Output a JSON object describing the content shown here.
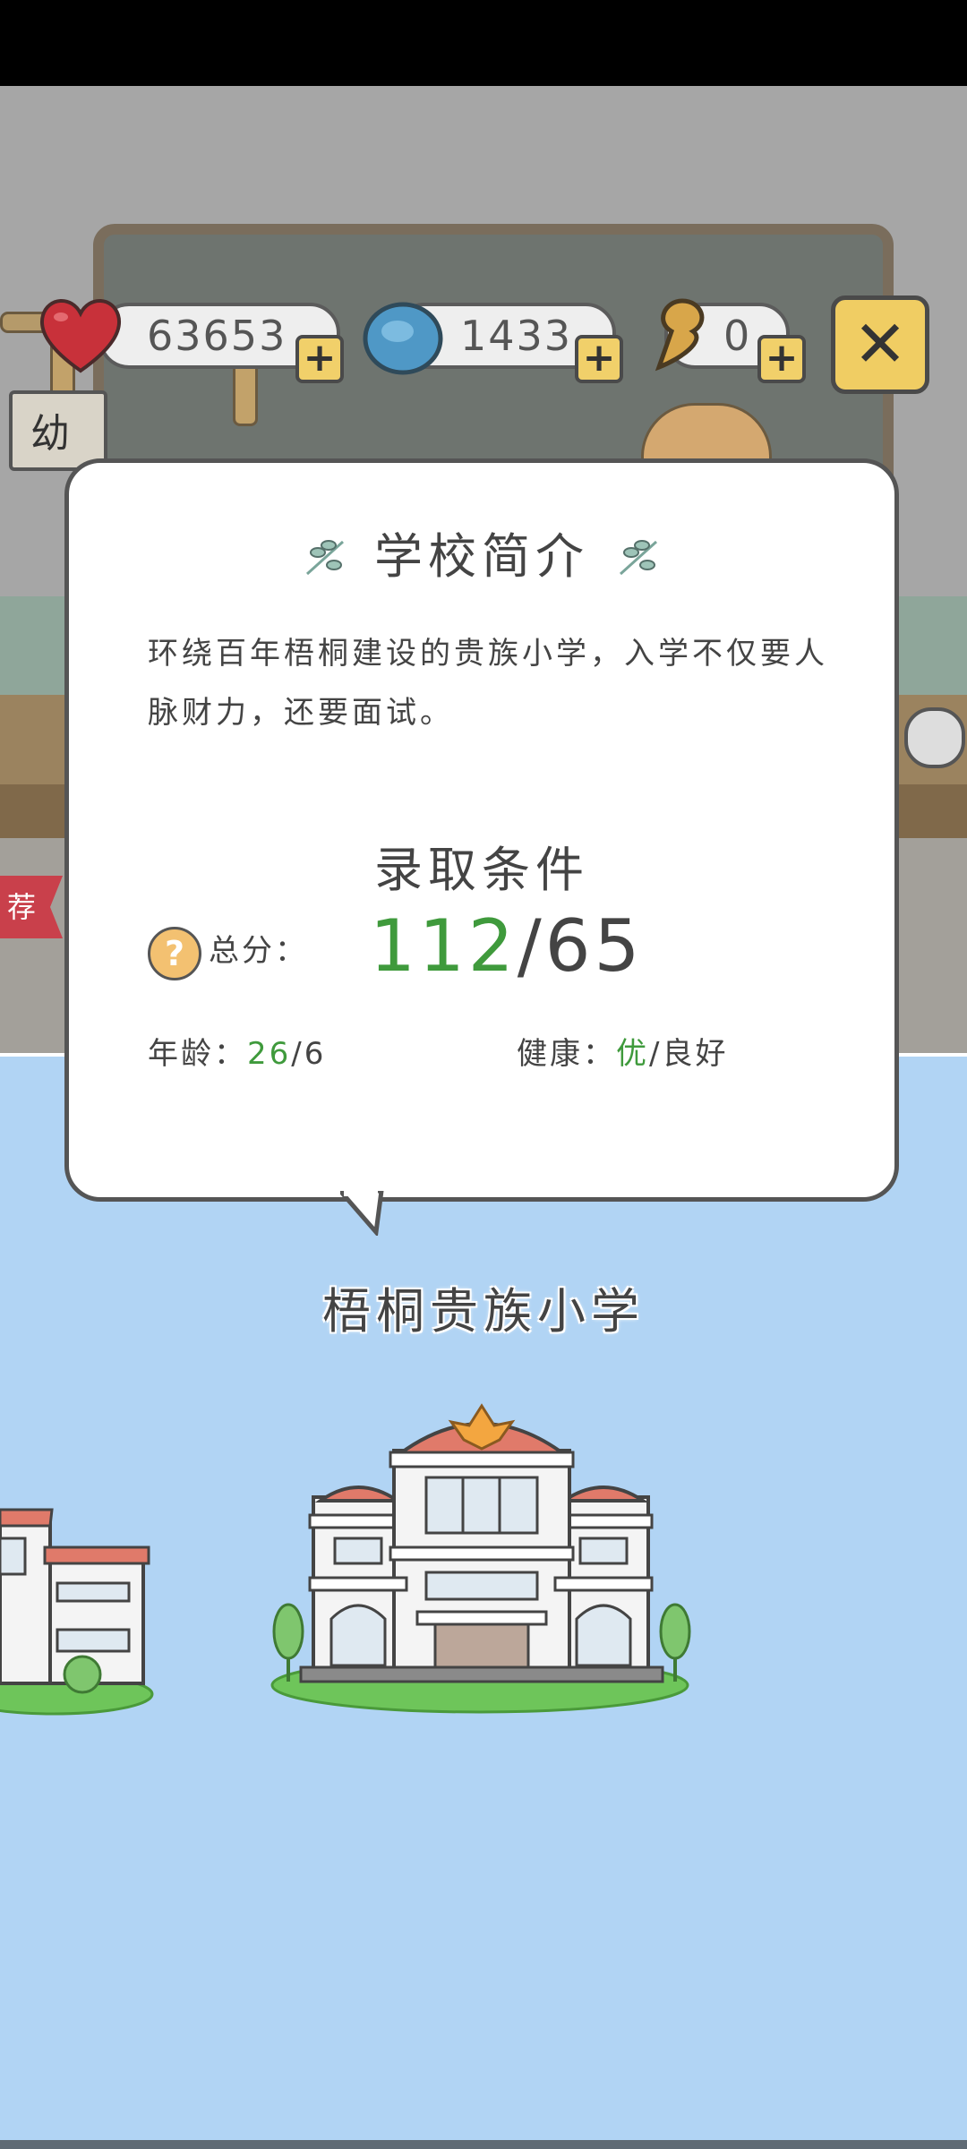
{
  "currency": {
    "hearts": "63653",
    "coins": "1433",
    "energy": "0",
    "add_symbol": "+",
    "heart_color": "#c8313a",
    "coin_color": "#4f98c6"
  },
  "close_symbol": "✕",
  "background": {
    "kindergarten_sign": "幼",
    "recommend_ribbon": "荐"
  },
  "popup": {
    "title": "学校简介",
    "intro": "环绕百年梧桐建设的贵族小学，入学不仅要人脉财力，还要面试。",
    "requirements_title": "录取条件",
    "score_label": "总分：",
    "score_current": "112",
    "score_separator": "/",
    "score_required": "65",
    "age_label": "年龄：",
    "age_current": "26",
    "age_required": "6",
    "health_label": "健康：",
    "health_current": "优",
    "health_required": "良好",
    "separator": "/"
  },
  "school": {
    "name": "梧桐贵族小学"
  },
  "colors": {
    "sky": "#b1d4f4",
    "pass_green": "#3f9a3c",
    "button_yellow": "#f0cd63"
  }
}
